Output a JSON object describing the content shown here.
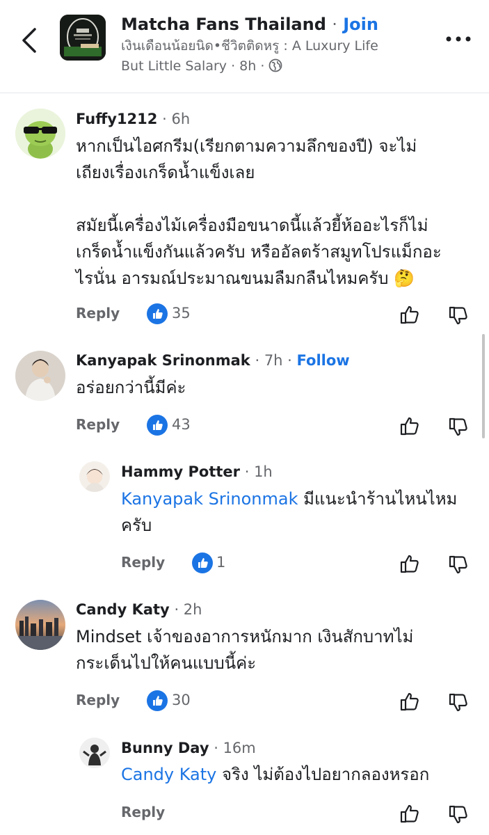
{
  "header": {
    "back_icon": "chevron-left-icon",
    "group_name": "Matcha Fans Thailand",
    "separator": "·",
    "join_label": "Join",
    "author_line_1": "เงินเดือนน้อยนิด•ชีวิตติดหรู : A Luxury Life",
    "author_line_2": "But Little Salary",
    "post_time": "8h",
    "privacy_icon": "globe-icon",
    "more_icon": "more-horizontal-icon"
  },
  "comments": [
    {
      "author": "Fuffy1212",
      "time": "6h",
      "lines": [
        "หากเป็นไอศกรีม(เรียกตามความลึกของปี) จะไม่",
        "เถียงเรื่องเกร็ดน้ำแข็งเลย",
        "",
        "สมัยนี้เครื่องไม้เครื่องมือขนาดนี้แล้วยี้ห้ออะไรก็ไม่",
        "เกร็ดน้ำแข็งกันแล้วครับ หรืออัลตร้าสมูทโปรแม็กอะ",
        "ไรนั่น อารมณ์ประมาณขนมลืมกลืนไหมครับ"
      ],
      "emoji": "🤔",
      "reply_label": "Reply",
      "likes": "35"
    },
    {
      "author": "Kanyapak Srinonmak",
      "time": "7h",
      "follow_label": "Follow",
      "lines": [
        "อร่อยกว่านี้มีค่ะ"
      ],
      "reply_label": "Reply",
      "likes": "43"
    },
    {
      "author": "Hammy Potter",
      "time": "1h",
      "mention": "Kanyapak Srinonmak",
      "lines": [
        "มีแนะนำร้านไหนไหม",
        "ครับ"
      ],
      "reply_label": "Reply",
      "likes": "1"
    },
    {
      "author": "Candy Katy",
      "time": "2h",
      "lines": [
        "Mindset เจ้าของอาการหนักมาก เงินสักบาทไม่",
        "กระเด็นไปให้คนแบบนี้ค่ะ"
      ],
      "reply_label": "Reply",
      "likes": "30"
    },
    {
      "author": "Bunny Day",
      "time": "16m",
      "mention": "Candy Katy",
      "lines": [
        "จริง ไม่ต้องไปอยากลองหรอก"
      ],
      "reply_label": "Reply"
    }
  ],
  "colors": {
    "accent": "#1b74e4",
    "secondary_text": "#65676b",
    "primary_text": "#1c1e21"
  }
}
